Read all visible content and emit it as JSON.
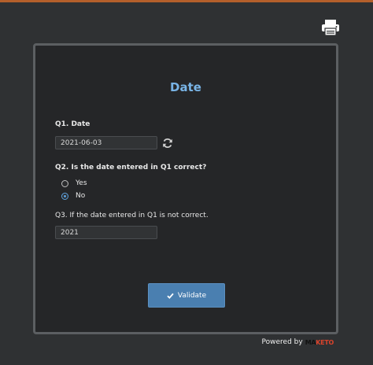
{
  "form": {
    "title": "Date",
    "q1": {
      "label": "Q1. Date",
      "value": "2021-06-03"
    },
    "q2": {
      "label": "Q2. Is the date entered in Q1 correct?",
      "options": [
        {
          "label": "Yes",
          "checked": false
        },
        {
          "label": "No",
          "checked": true
        }
      ]
    },
    "q3": {
      "label": "Q3. If the date entered in Q1 is not correct.",
      "value": "2021"
    },
    "validate_label": "Validate"
  },
  "footer": {
    "powered_by": "Powered by",
    "brand_main": "MA",
    "brand_accent": "KETO"
  },
  "icons": {
    "print": "print-icon",
    "refresh": "refresh-icon",
    "check": "check-icon"
  },
  "colors": {
    "accent_top": "#b45f2b",
    "title": "#79b4e6",
    "button": "#4a7fb0",
    "background": "#2f3133",
    "card": "#252628"
  }
}
